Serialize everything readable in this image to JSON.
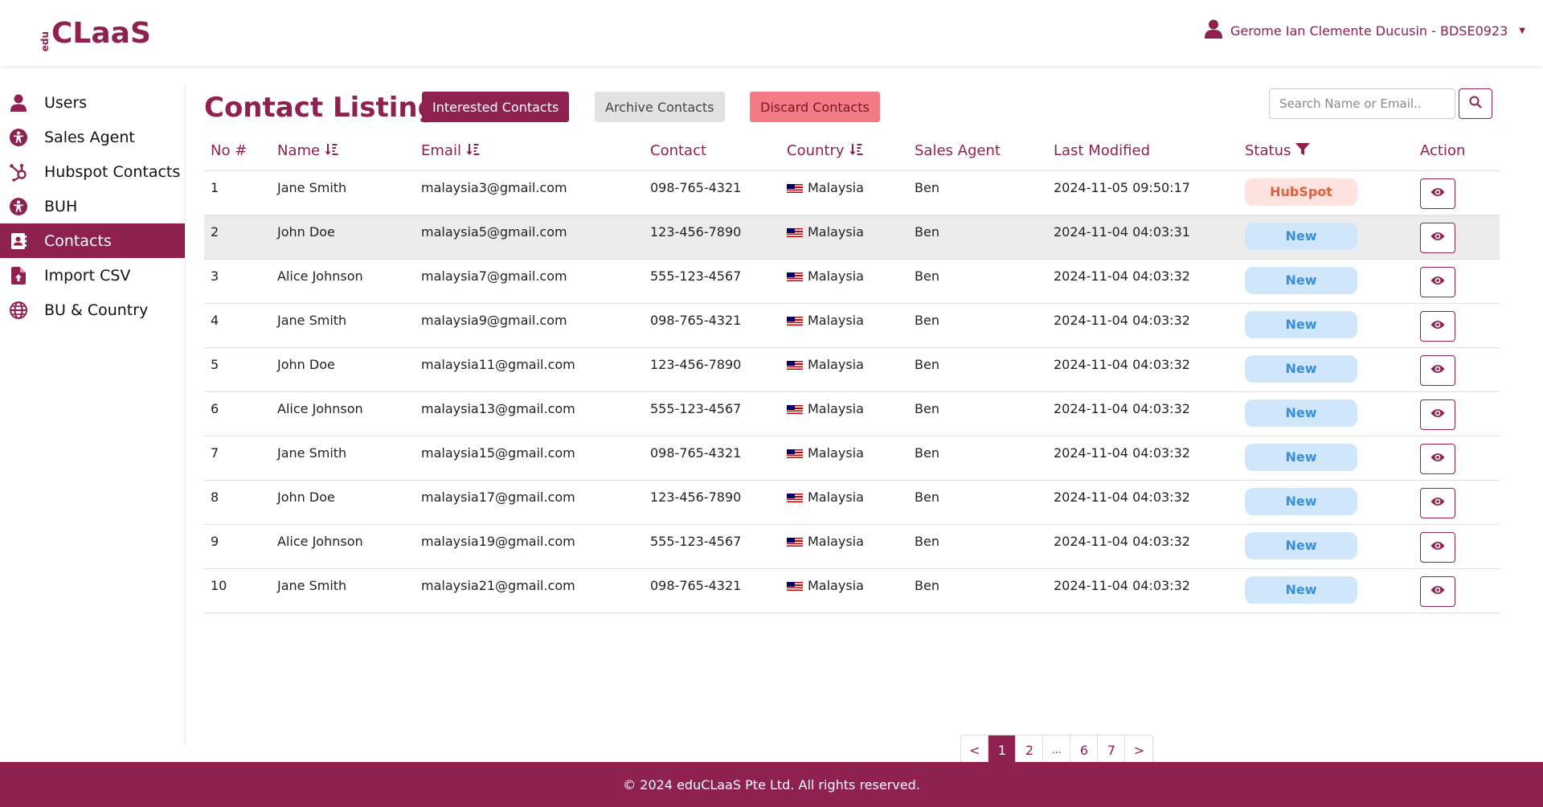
{
  "header": {
    "logo_small": "edu",
    "logo_big": "CLaaS",
    "user_name": "Gerome Ian Clemente Ducusin - BDSE0923"
  },
  "sidebar": {
    "items": [
      {
        "label": "Users",
        "icon": "user-icon"
      },
      {
        "label": "Sales Agent",
        "icon": "accessibility-icon"
      },
      {
        "label": "Hubspot Contacts",
        "icon": "hubspot-icon"
      },
      {
        "label": "BUH",
        "icon": "accessibility-icon"
      },
      {
        "label": "Contacts",
        "icon": "address-book-icon",
        "active": true
      },
      {
        "label": "Import CSV",
        "icon": "file-import-icon"
      },
      {
        "label": "BU & Country",
        "icon": "globe-icon"
      }
    ]
  },
  "main": {
    "title": "Contact Listing",
    "buttons": {
      "interested": "Interested Contacts",
      "archive": "Archive Contacts",
      "discard": "Discard Contacts"
    },
    "search_placeholder": "Search Name or Email..",
    "columns": [
      "No #",
      "Name",
      "Email",
      "Contact",
      "Country",
      "Sales Agent",
      "Last Modified",
      "Status",
      "Action"
    ],
    "rows": [
      {
        "no": "1",
        "name": "Jane Smith",
        "email": "malaysia3@gmail.com",
        "contact": "098-765-4321",
        "country": "Malaysia",
        "agent": "Ben",
        "modified": "2024-11-05 09:50:17",
        "status": "HubSpot"
      },
      {
        "no": "2",
        "name": "John Doe",
        "email": "malaysia5@gmail.com",
        "contact": "123-456-7890",
        "country": "Malaysia",
        "agent": "Ben",
        "modified": "2024-11-04 04:03:31",
        "status": "New"
      },
      {
        "no": "3",
        "name": "Alice Johnson",
        "email": "malaysia7@gmail.com",
        "contact": "555-123-4567",
        "country": "Malaysia",
        "agent": "Ben",
        "modified": "2024-11-04 04:03:32",
        "status": "New"
      },
      {
        "no": "4",
        "name": "Jane Smith",
        "email": "malaysia9@gmail.com",
        "contact": "098-765-4321",
        "country": "Malaysia",
        "agent": "Ben",
        "modified": "2024-11-04 04:03:32",
        "status": "New"
      },
      {
        "no": "5",
        "name": "John Doe",
        "email": "malaysia11@gmail.com",
        "contact": "123-456-7890",
        "country": "Malaysia",
        "agent": "Ben",
        "modified": "2024-11-04 04:03:32",
        "status": "New"
      },
      {
        "no": "6",
        "name": "Alice Johnson",
        "email": "malaysia13@gmail.com",
        "contact": "555-123-4567",
        "country": "Malaysia",
        "agent": "Ben",
        "modified": "2024-11-04 04:03:32",
        "status": "New"
      },
      {
        "no": "7",
        "name": "Jane Smith",
        "email": "malaysia15@gmail.com",
        "contact": "098-765-4321",
        "country": "Malaysia",
        "agent": "Ben",
        "modified": "2024-11-04 04:03:32",
        "status": "New"
      },
      {
        "no": "8",
        "name": "John Doe",
        "email": "malaysia17@gmail.com",
        "contact": "123-456-7890",
        "country": "Malaysia",
        "agent": "Ben",
        "modified": "2024-11-04 04:03:32",
        "status": "New"
      },
      {
        "no": "9",
        "name": "Alice Johnson",
        "email": "malaysia19@gmail.com",
        "contact": "555-123-4567",
        "country": "Malaysia",
        "agent": "Ben",
        "modified": "2024-11-04 04:03:32",
        "status": "New"
      },
      {
        "no": "10",
        "name": "Jane Smith",
        "email": "malaysia21@gmail.com",
        "contact": "098-765-4321",
        "country": "Malaysia",
        "agent": "Ben",
        "modified": "2024-11-04 04:03:32",
        "status": "New"
      }
    ]
  },
  "pagination": {
    "prev": "<",
    "pages": [
      "1",
      "2",
      "...",
      "6",
      "7"
    ],
    "current": "1",
    "next": ">"
  },
  "footer": {
    "text": "© 2024 eduCLaaS Pte Ltd. All rights reserved."
  },
  "colors": {
    "brand": "#8f2151",
    "new_badge_bg": "#cfe6fb",
    "hubspot_badge_bg": "#fde2dd"
  }
}
